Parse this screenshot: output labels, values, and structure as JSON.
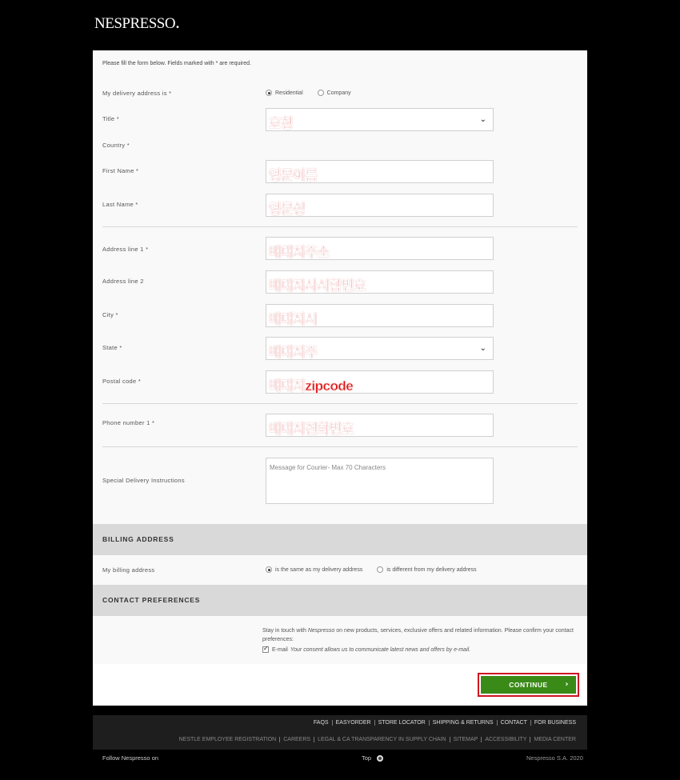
{
  "brand": {
    "logo_text": "NESPRESSO",
    "logo_mark": "."
  },
  "form": {
    "intro": "Please fill the form below. Fields marked with * are required.",
    "delivery_type": {
      "label": "My delivery address is *",
      "options": [
        "Residential",
        "Company"
      ],
      "selected": "Residential"
    },
    "title": {
      "label": "Title *",
      "value": "호칭"
    },
    "country": {
      "label": "Country *"
    },
    "first_name": {
      "label": "First Name *",
      "value": "영문이름"
    },
    "last_name": {
      "label": "Last Name *",
      "value": "영문성"
    },
    "address1": {
      "label": "Address line 1 *",
      "value": "배대지주소"
    },
    "address2": {
      "label": "Address line 2",
      "value": "배대지사서함번호"
    },
    "city": {
      "label": "City *",
      "value": "배대지시"
    },
    "state": {
      "label": "State *",
      "value": "배대지주"
    },
    "postal": {
      "label": "Postal code *",
      "value": "배대지zipcode"
    },
    "phone": {
      "label": "Phone number 1 *",
      "value": "배대지전화번호"
    },
    "instructions": {
      "label": "Special Delivery Instructions",
      "placeholder": "Message for Courier- Max 70 Characters"
    }
  },
  "billing": {
    "heading": "BILLING ADDRESS",
    "label": "My billing address",
    "options": [
      "is the same as my delivery address",
      "is different from my delivery address"
    ],
    "selected": "is the same as my delivery address"
  },
  "contact": {
    "heading": "CONTACT PREFERENCES",
    "text_before": "Stay in touch with ",
    "brand_italic": "Nespresso",
    "text_after": " on new products, services, exclusive offers and related information. Please confirm your contact preferences:",
    "email_label": "E-mail",
    "email_note": "Your consent allows us to communicate latest news and offers by e-mail.",
    "email_checked": true
  },
  "continue_label": "CONTINUE",
  "footer": {
    "links1": [
      "FAQS",
      "EASYORDER",
      "STORE LOCATOR",
      "SHIPPING & RETURNS",
      "CONTACT",
      "FOR BUSINESS"
    ],
    "links2": [
      "NESTLE EMPLOYEE REGISTRATION",
      "CAREERS",
      "LEGAL & CA TRANSPARENCY IN SUPPLY CHAIN",
      "SITEMAP",
      "ACCESSIBILITY",
      "MEDIA CENTER"
    ],
    "follow": "Follow Nespresso on",
    "top": "Top",
    "copyright": "Nespresso S.A. 2020"
  },
  "colors": {
    "accent_green": "#3a8a17",
    "highlight_red": "#d01020",
    "annotation_red": "#e01010"
  }
}
